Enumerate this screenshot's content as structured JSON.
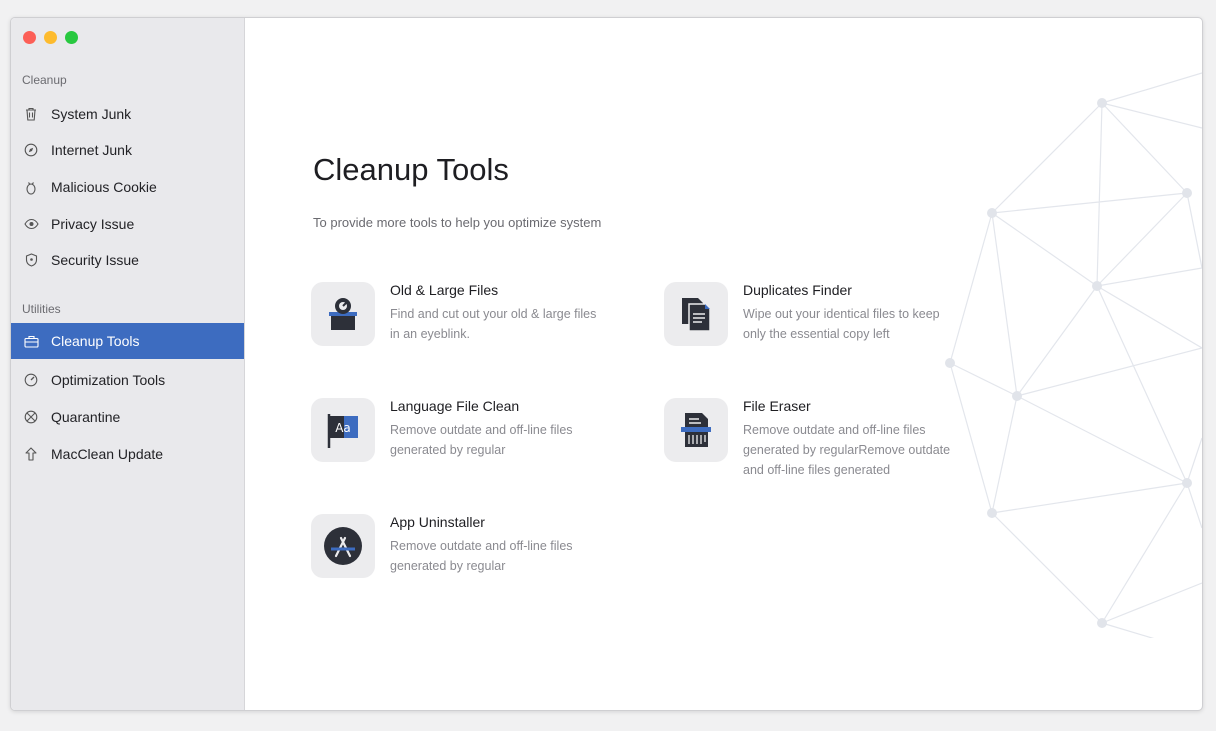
{
  "sidebar": {
    "sections": {
      "cleanup": "Cleanup",
      "utilities": "Utilities"
    },
    "items": [
      {
        "label": "System Junk",
        "icon": "trash-icon"
      },
      {
        "label": "Internet Junk",
        "icon": "compass-icon"
      },
      {
        "label": "Malicious Cookie",
        "icon": "bug-icon"
      },
      {
        "label": "Privacy Issue",
        "icon": "eye-icon"
      },
      {
        "label": "Security Issue",
        "icon": "shield-icon"
      },
      {
        "label": "Cleanup Tools",
        "icon": "toolbox-icon",
        "active": true
      },
      {
        "label": "Optimization Tools",
        "icon": "gauge-icon"
      },
      {
        "label": "Quarantine",
        "icon": "quarantine-icon"
      },
      {
        "label": "MacClean Update",
        "icon": "upload-arrow-icon"
      }
    ]
  },
  "main": {
    "title": "Cleanup Tools",
    "subtitle": "To provide more tools to help you optimize system",
    "tools": [
      {
        "name": "Old & Large Files",
        "desc": "Find and cut out your old & large files in an eyeblink.",
        "icon": "old-large-files-icon"
      },
      {
        "name": "Duplicates Finder",
        "desc": "Wipe out your identical files to keep only the essential copy left",
        "icon": "duplicates-icon"
      },
      {
        "name": "Language File Clean",
        "desc": "Remove outdate and off-line files generated by regular",
        "icon": "language-flag-icon"
      },
      {
        "name": "File Eraser",
        "desc": "Remove outdate and off-line files generated by regularRemove outdate and off-line files generated",
        "icon": "shredder-icon"
      },
      {
        "name": "App Uninstaller",
        "desc": "Remove outdate and off-line files generated by regular",
        "icon": "app-store-icon"
      }
    ]
  },
  "colors": {
    "accent": "#3d6cc0",
    "sidebar_bg": "#e9e9ec",
    "icon_dark": "#2d3039"
  }
}
